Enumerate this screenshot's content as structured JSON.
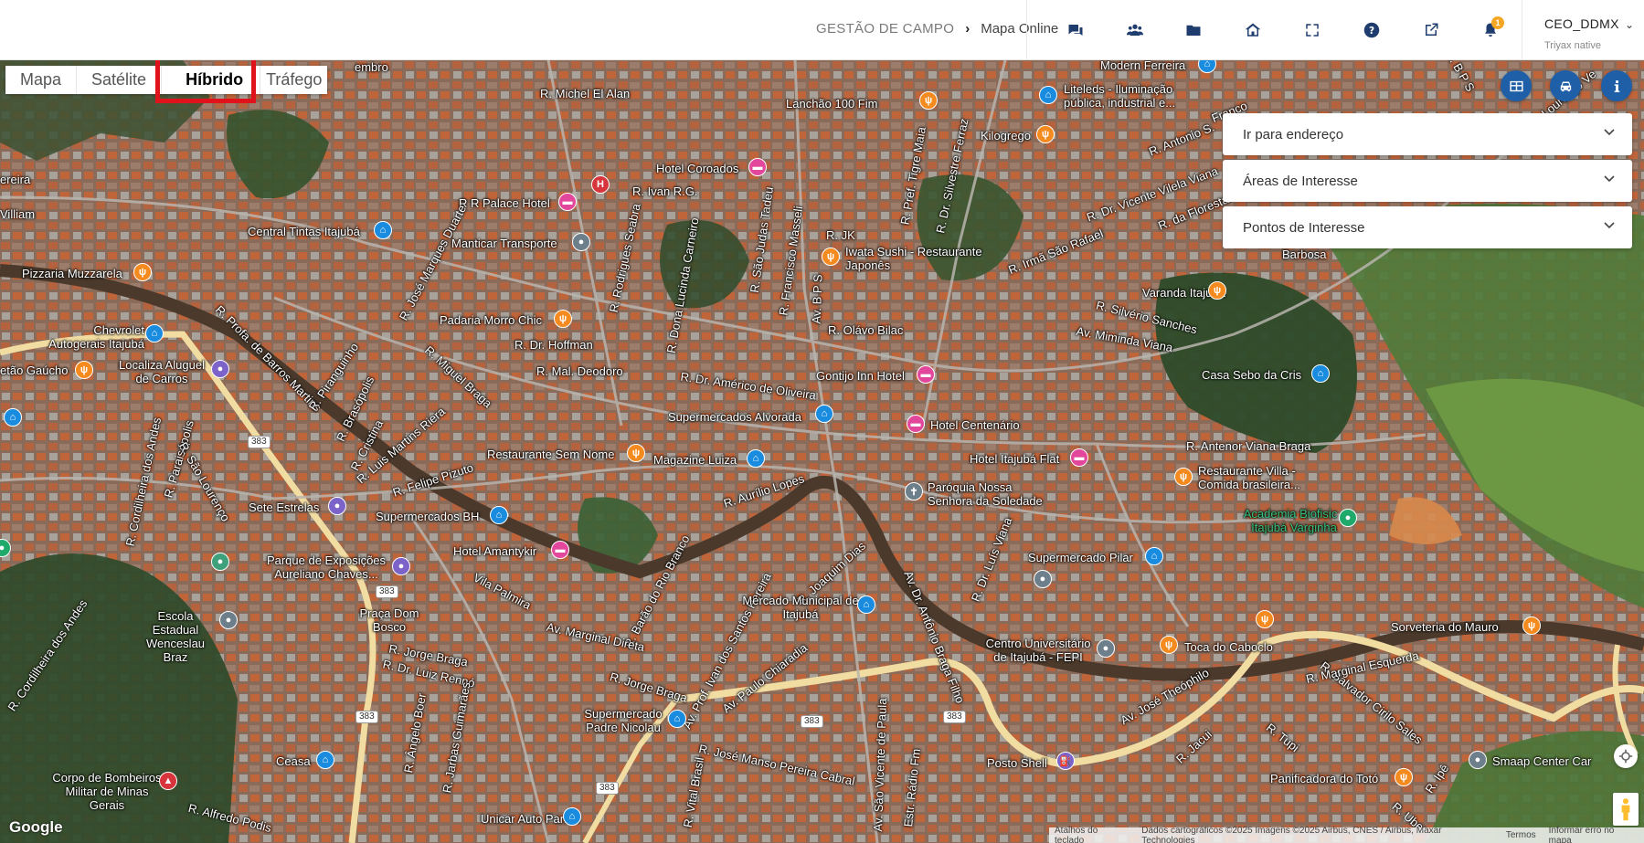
{
  "header": {
    "breadcrumb_root": "GESTÃO DE CAMPO",
    "breadcrumb_sep": "›",
    "breadcrumb_current": "Mapa Online",
    "icons": [
      "chat-icon",
      "users-icon",
      "folder-icon",
      "home-icon",
      "fullscreen-icon",
      "help-icon",
      "external-link-icon",
      "bell-icon"
    ],
    "notification_count": "1",
    "user_name": "CEO_DDMX",
    "user_sub": "Triyax native"
  },
  "map_types": [
    "Mapa",
    "Satélite",
    "Híbrido",
    "Tráfego"
  ],
  "map_type_selected": "Híbrido",
  "panels": {
    "address": "Ir para endereço",
    "areas": "Áreas de Interesse",
    "points": "Pontos de Interesse"
  },
  "streets": {
    "michel": "R. Michel El Alan",
    "ivan": "R. Ivan R.G.",
    "palace": "R R Palace Hotel",
    "marques": "R. José Marques Duarte",
    "rodrigues": "R. Rodrigues Seabra",
    "lucinda": "R. Dona Lucinda Carneiro",
    "tadeu": "R. São Judas Tadeu",
    "masseli": "R. Francisco Masseli",
    "bps": "Av. B P S",
    "jk": "R. JK",
    "tigre": "R. Pref. Tigre Maia",
    "silvestre": "R. Dr. Silvestre Ferraz",
    "rafael": "R. Irmã São Rafael",
    "vicente": "R. Dr. Vicente Vilela Viana",
    "antonio_s": "R. Antonio S.",
    "franco": "Franco",
    "dafloresta": "R. da Floresta",
    "barbosa": "Barbosa",
    "bilac": "R. Olávo Bilac",
    "hoffman": "R. Dr. Hoffman",
    "deodoro": "R. Mal. Deodoro",
    "americo": "R. Dr. Américo de Oliveira",
    "sanches": "R. Silvério Sanches",
    "miminda": "Av. Miminda Viana",
    "barros": "R. Profa. de Barros Martins",
    "piranguinho": "R. Piranguinho",
    "brasopolis": "R. Brasópolis",
    "cristina": "R. Cristina",
    "luis_martins": "R. Luis Martins Riera",
    "miguel": "R. Miguel Braga",
    "felipe": "R. Felipe Pizuto",
    "aurilio": "R. Aurílio Lopes",
    "antenor": "R. Antenor Viana Braga",
    "cordilheira_andes": "R. Cordilheira dos Andes",
    "paraisopolis": "R. Paraisópolis",
    "sao_lourenco": "R. São Lourenço",
    "vila_palmira": "Vila Palmira",
    "barao": "R. Barão do Rio Branco",
    "joaquim": "R. Joaquim Dias",
    "marginal_direta": "Av. Marginal Direta",
    "ivan_santos": "Av. Prof. Ivan dos Santos Pereira",
    "paulo": "Av. Paulo Chiaradia",
    "antonio_braga": "Av. Dr. Antônio Braga Filho",
    "luis_viana": "R. Dr. Luís Viana",
    "jorge": "R. Jorge Braga",
    "jorge2": "R. Jorge Braga",
    "luiz_renno": "R. Dr. Luiz Rennó",
    "cordilheira2": "R. Cordilheira dos Andes",
    "angelo": "R. Ângelo Boer",
    "jarbas": "R. Jarbas Guimarães",
    "manso": "R. José Manso Pereira Cabral",
    "vital": "R. Vital Brasil",
    "sao_vicente": "Av. São Vicente de Paula",
    "radio": "Estr. Rádio Fm",
    "theophilo": "Av. José Theóphilo",
    "jacui": "R. Jacui",
    "tupi": "R. Tupi",
    "cirilo": "R. Salvador Cirilo Sales",
    "marginal_esquerda": "R. Marginal Esquerda",
    "ipe": "R. Ipê",
    "uber": "R. Uber",
    "agripo": "R. Alfredo Podis",
    "praca": "Praça Dom Bosco",
    "ereira": "ereira",
    "villiam": "Villiam",
    "embro": "embro",
    "lourenco": "Lourenço Ve",
    "rbps": "R. B P S"
  },
  "road_shields": [
    "383",
    "383",
    "383",
    "383",
    "383",
    "383"
  ],
  "pois": {
    "central_tintas": "Central Tintas Itajubá",
    "manticar": "Manticar Transporte",
    "pizzaria": "Pizzaria Muzzarela",
    "hotel_coroados": "Hotel Coroados",
    "lanchao": "Lanchão 100 Fim",
    "kilogrego": "Kilogrego",
    "liteleds": "Liteleds - Iluminação pública, industrial e...",
    "modern_ferreira": "Modern Ferreira",
    "iwata": "Iwata Sushi - Restaurante Japonês",
    "varanda": "Varanda Itajubá",
    "padaria": "Padaria Morro Chic",
    "chevrolet": "Chevrolet Autogerais Itajubá",
    "tao_gaucho": "etão Gaúcho",
    "localiza": "Localiza Aluguel de Carros",
    "gontijo": "Gontijo Inn Hotel",
    "casa_sebo": "Casa Sebo da Cris",
    "supermercados_alvorada": "Supermercados Alvorada",
    "hotel_centenario": "Hotel Centenário",
    "restaurante_sem_nome": "Restaurante Sem Nome",
    "magazine": "Magazine Luiza",
    "hotel_itajuba_flat": "Hotel Itajubá Flat",
    "restaurante_villa": "Restaurante Villa - Comida brasileira...",
    "paroquia": "Paróquia Nossa Senhora da Soledade",
    "academia": "Academia Biofisic - Itajubá Varginha",
    "sete_estrelas": "Sete Estrelas",
    "supermercados_bh": "Supermercados BH",
    "hotel_amantykir": "Hotel Amantykir",
    "parque": "Parque de Exposições Aureliano Chaves...",
    "supermercado_pilar": "Supermercado Pilar",
    "escola": "Escola Estadual Wenceslau Braz",
    "mercado": "Mercado Municipal de Itajubá",
    "sorveteria": "Sorveteria do Mauro",
    "centro": "Centro Universitário de Itajubá - FEPI",
    "toca": "Toca do Caboclo",
    "supermercado_padre": "Supermercado Padre Nicolau",
    "ceasa": "Ceasa",
    "corpo_bombeiros": "Corpo de Bombeiros Militar de Minas Gerais",
    "posto_shell": "Posto Shell",
    "panificadora": "Panificadora do Totó",
    "smaap": "Smaap Center Car",
    "unicar": "Unicar Auto Partes"
  },
  "footer": {
    "google": "Google",
    "shortcuts": "Atalhos do teclado",
    "data": "Dados cartográficos ©2025 Imagens ©2025 Airbus, CNES / Airbus, Maxar Technologies",
    "terms": "Termos",
    "report": "Informar erro no mapa"
  },
  "colors": {
    "accent": "#1f5fa8",
    "highlight": "#e0121c",
    "food": "#f58a1f",
    "shop": "#1a8ce0",
    "hotel": "#e2479b"
  }
}
